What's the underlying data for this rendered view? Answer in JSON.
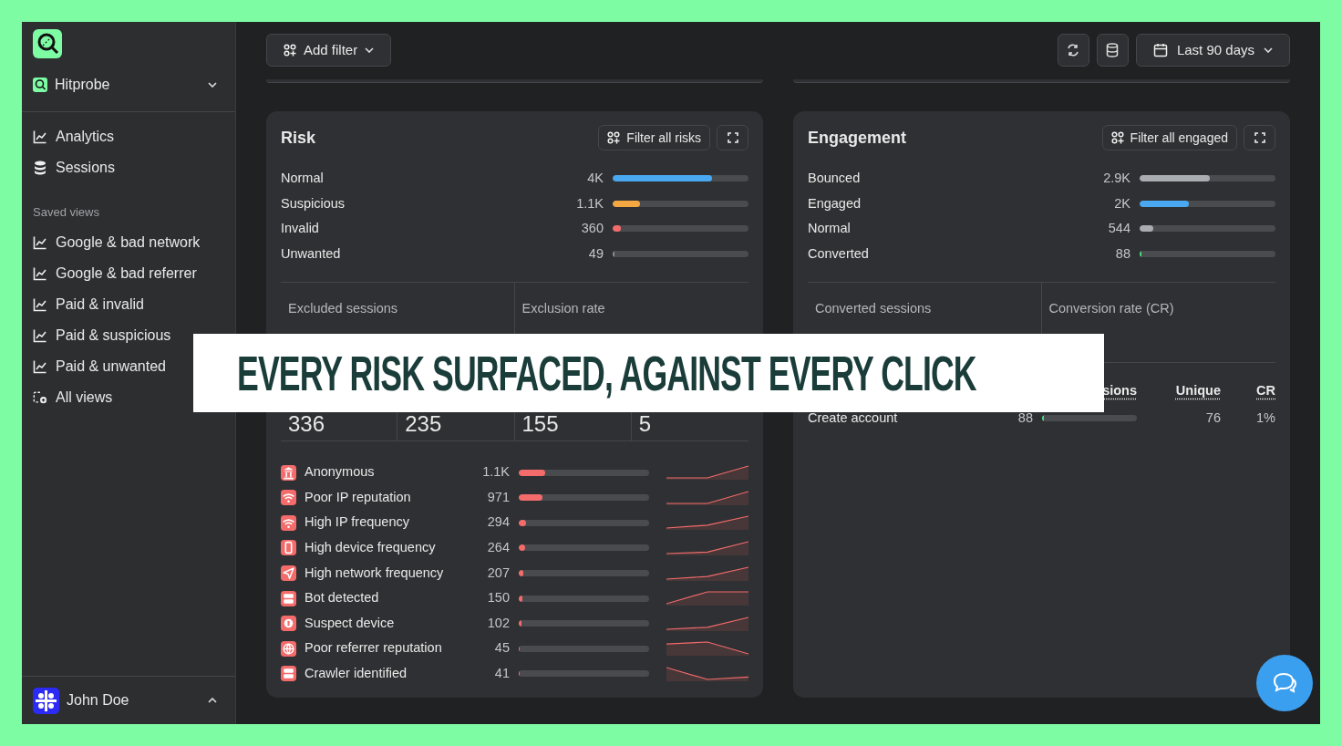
{
  "sidebar": {
    "workspace": "Hitprobe",
    "nav": [
      {
        "label": "Analytics",
        "kind": "chart"
      },
      {
        "label": "Sessions",
        "kind": "database"
      }
    ],
    "section_title": "Saved views",
    "views": [
      {
        "label": "Google & bad network",
        "kind": "chart"
      },
      {
        "label": "Google & bad referrer",
        "kind": "chart"
      },
      {
        "label": "Paid & invalid",
        "kind": "chart"
      },
      {
        "label": "Paid & suspicious",
        "kind": "chart"
      },
      {
        "label": "Paid & unwanted",
        "kind": "chart"
      },
      {
        "label": "All views",
        "kind": "add"
      }
    ],
    "user": "John Doe"
  },
  "toolbar": {
    "add_filter": "Add filter",
    "date_range": "Last 90 days"
  },
  "risk": {
    "title": "Risk",
    "filter_button": "Filter all risks",
    "rows": [
      {
        "label": "Normal",
        "value": "4K",
        "level": 0.73,
        "color": "#4aa8f0"
      },
      {
        "label": "Suspicious",
        "value": "1.1K",
        "level": 0.2,
        "color": "#f5a742"
      },
      {
        "label": "Invalid",
        "value": "360",
        "level": 0.06,
        "color": "#f46b6b"
      },
      {
        "label": "Unwanted",
        "value": "49",
        "level": 0.012,
        "color": "#8a8c90"
      }
    ],
    "stats": [
      {
        "label": "Excluded sessions"
      },
      {
        "label": "Exclusion rate"
      }
    ],
    "breakdown": [
      "336",
      "235",
      "155",
      "5"
    ],
    "signals": [
      {
        "label": "Anonymous",
        "value": "1.1K",
        "level": 0.2,
        "kind": "building"
      },
      {
        "label": "Poor IP reputation",
        "value": "971",
        "level": 0.18,
        "kind": "wifi"
      },
      {
        "label": "High IP frequency",
        "value": "294",
        "level": 0.055,
        "kind": "wifi"
      },
      {
        "label": "High device frequency",
        "value": "264",
        "level": 0.048,
        "kind": "phone"
      },
      {
        "label": "High network frequency",
        "value": "207",
        "level": 0.038,
        "kind": "send"
      },
      {
        "label": "Bot detected",
        "value": "150",
        "level": 0.027,
        "kind": "server"
      },
      {
        "label": "Suspect device",
        "value": "102",
        "level": 0.018,
        "kind": "chip"
      },
      {
        "label": "Poor referrer reputation",
        "value": "45",
        "level": 0.01,
        "kind": "globe"
      },
      {
        "label": "Crawler identified",
        "value": "41",
        "level": 0.01,
        "kind": "server"
      }
    ]
  },
  "engagement": {
    "title": "Engagement",
    "filter_button": "Filter all engaged",
    "rows": [
      {
        "label": "Bounced",
        "value": "2.9K",
        "level": 0.52,
        "color": "#a9acb0"
      },
      {
        "label": "Engaged",
        "value": "2K",
        "level": 0.36,
        "color": "#4aa8f0"
      },
      {
        "label": "Normal",
        "value": "544",
        "level": 0.1,
        "color": "#a9acb0"
      },
      {
        "label": "Converted",
        "value": "88",
        "level": 0.015,
        "color": "#4ade80"
      }
    ],
    "stats": [
      {
        "label": "Converted sessions"
      },
      {
        "label": "Conversion rate (CR)"
      }
    ],
    "table": {
      "columns": [
        "sions",
        "Unique",
        "CR"
      ],
      "rows": [
        {
          "name": "Create account",
          "count": "88",
          "level": 0.02,
          "unique": "76",
          "cr": "1%"
        }
      ]
    }
  },
  "banner": "EVERY RISK SURFACED, AGAINST EVERY CLICK"
}
